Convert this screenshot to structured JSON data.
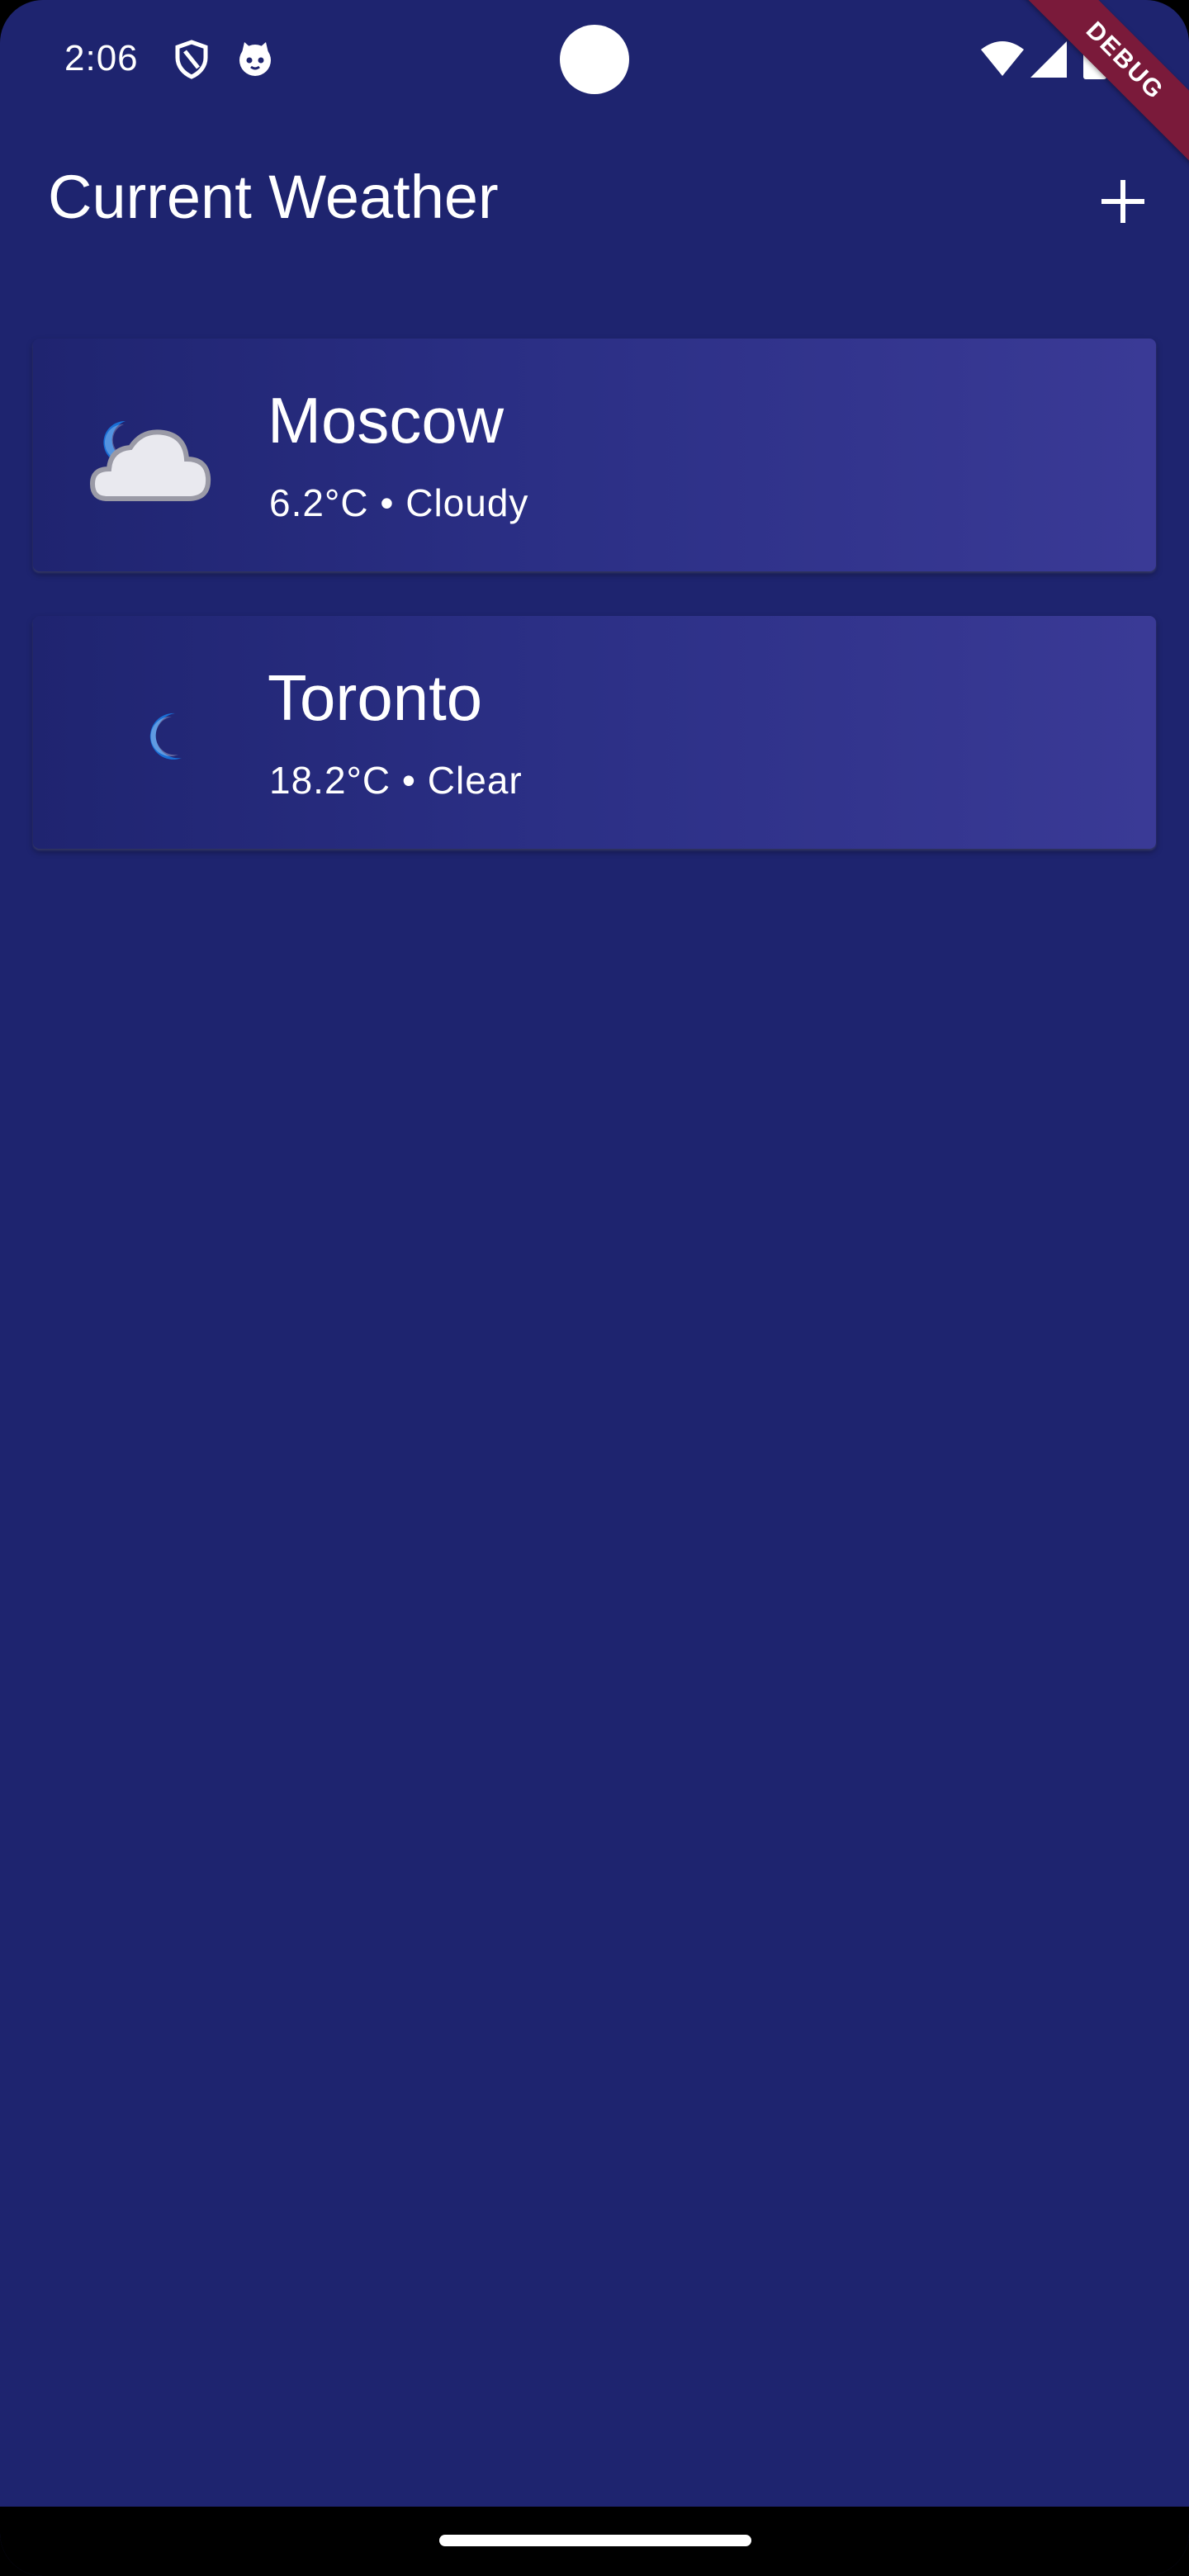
{
  "status_bar": {
    "time": "2:06",
    "icons": [
      "shield-icon",
      "cat-face-icon",
      "wifi-icon",
      "signal-icon",
      "battery-icon"
    ]
  },
  "debug_banner": {
    "label": "DEBUG"
  },
  "app_bar": {
    "title": "Current Weather",
    "add_icon": "plus-icon"
  },
  "cities": [
    {
      "name": "Moscow",
      "detail": "6.2°C • Cloudy",
      "icon": "moon-cloud-icon"
    },
    {
      "name": "Toronto",
      "detail": "18.2°C • Clear",
      "icon": "moon-icon"
    }
  ],
  "colors": {
    "background": "#1e246f",
    "card_gradient_start": "#1f2470",
    "card_gradient_end": "#3a3a96",
    "moon": "#1a6fd6",
    "cloud": "#e8e8ee",
    "debug": "#7a1a3a"
  }
}
